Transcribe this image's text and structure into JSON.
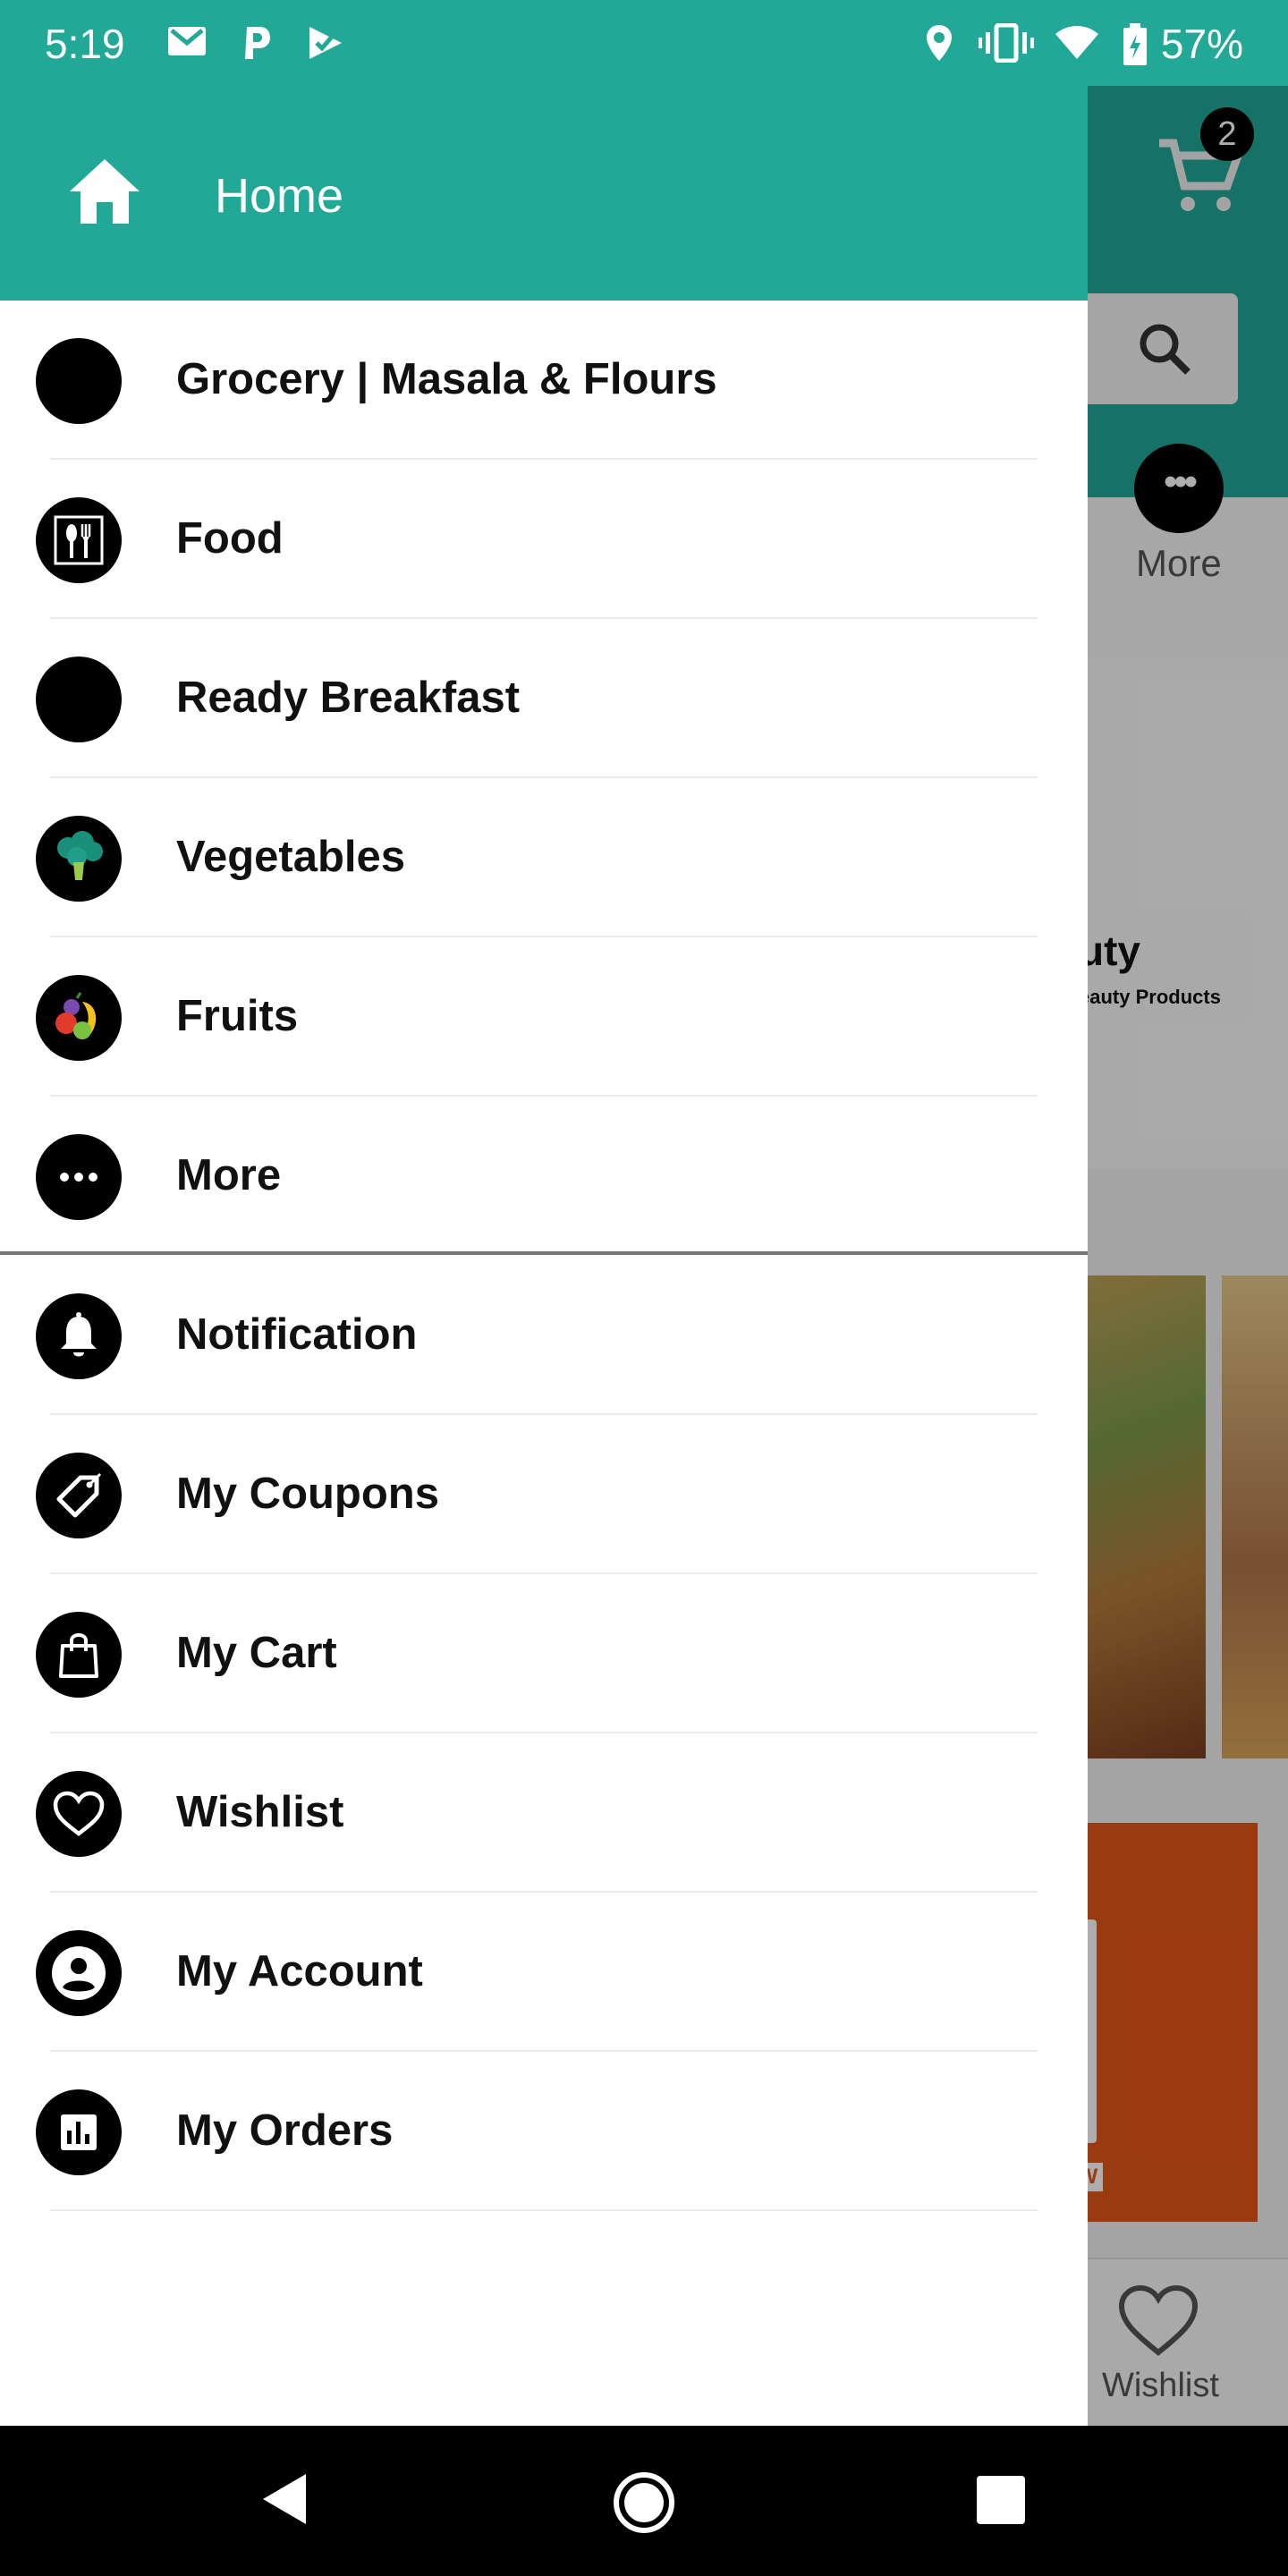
{
  "status_bar": {
    "time": "5:19",
    "battery_text": "57%",
    "icons": [
      "gmail-icon",
      "p-app-icon",
      "play-icon",
      "location-icon",
      "vibrate-icon",
      "wifi-icon",
      "battery-icon"
    ]
  },
  "drawer": {
    "header": {
      "home_label": "Home",
      "home_icon": "home-icon"
    },
    "primary_items": [
      {
        "label": "Grocery | Masala & Flours",
        "icon": "grocery-icon"
      },
      {
        "label": "Food",
        "icon": "food-icon"
      },
      {
        "label": "Ready Breakfast",
        "icon": "breakfast-icon"
      },
      {
        "label": "Vegetables",
        "icon": "vegetables-icon"
      },
      {
        "label": "Fruits",
        "icon": "fruits-icon"
      },
      {
        "label": "More",
        "icon": "more-icon"
      }
    ],
    "secondary_items": [
      {
        "label": "Notification",
        "icon": "bell-icon"
      },
      {
        "label": "My Coupons",
        "icon": "coupon-icon"
      },
      {
        "label": "My Cart",
        "icon": "bag-icon"
      },
      {
        "label": "Wishlist",
        "icon": "heart-icon"
      },
      {
        "label": "My Account",
        "icon": "account-icon"
      },
      {
        "label": "My Orders",
        "icon": "orders-icon"
      }
    ]
  },
  "background_app": {
    "cart_badge": "2",
    "more_label": "More",
    "banner_title": "uty",
    "banner_subtitle": "eauty Products",
    "promo_tag": "OW",
    "wishlist_label": "Wishlist"
  },
  "colors": {
    "primary": "#21a897",
    "drawer_bg": "#ffffff",
    "text": "#111111",
    "icon_circle": "#000000"
  }
}
